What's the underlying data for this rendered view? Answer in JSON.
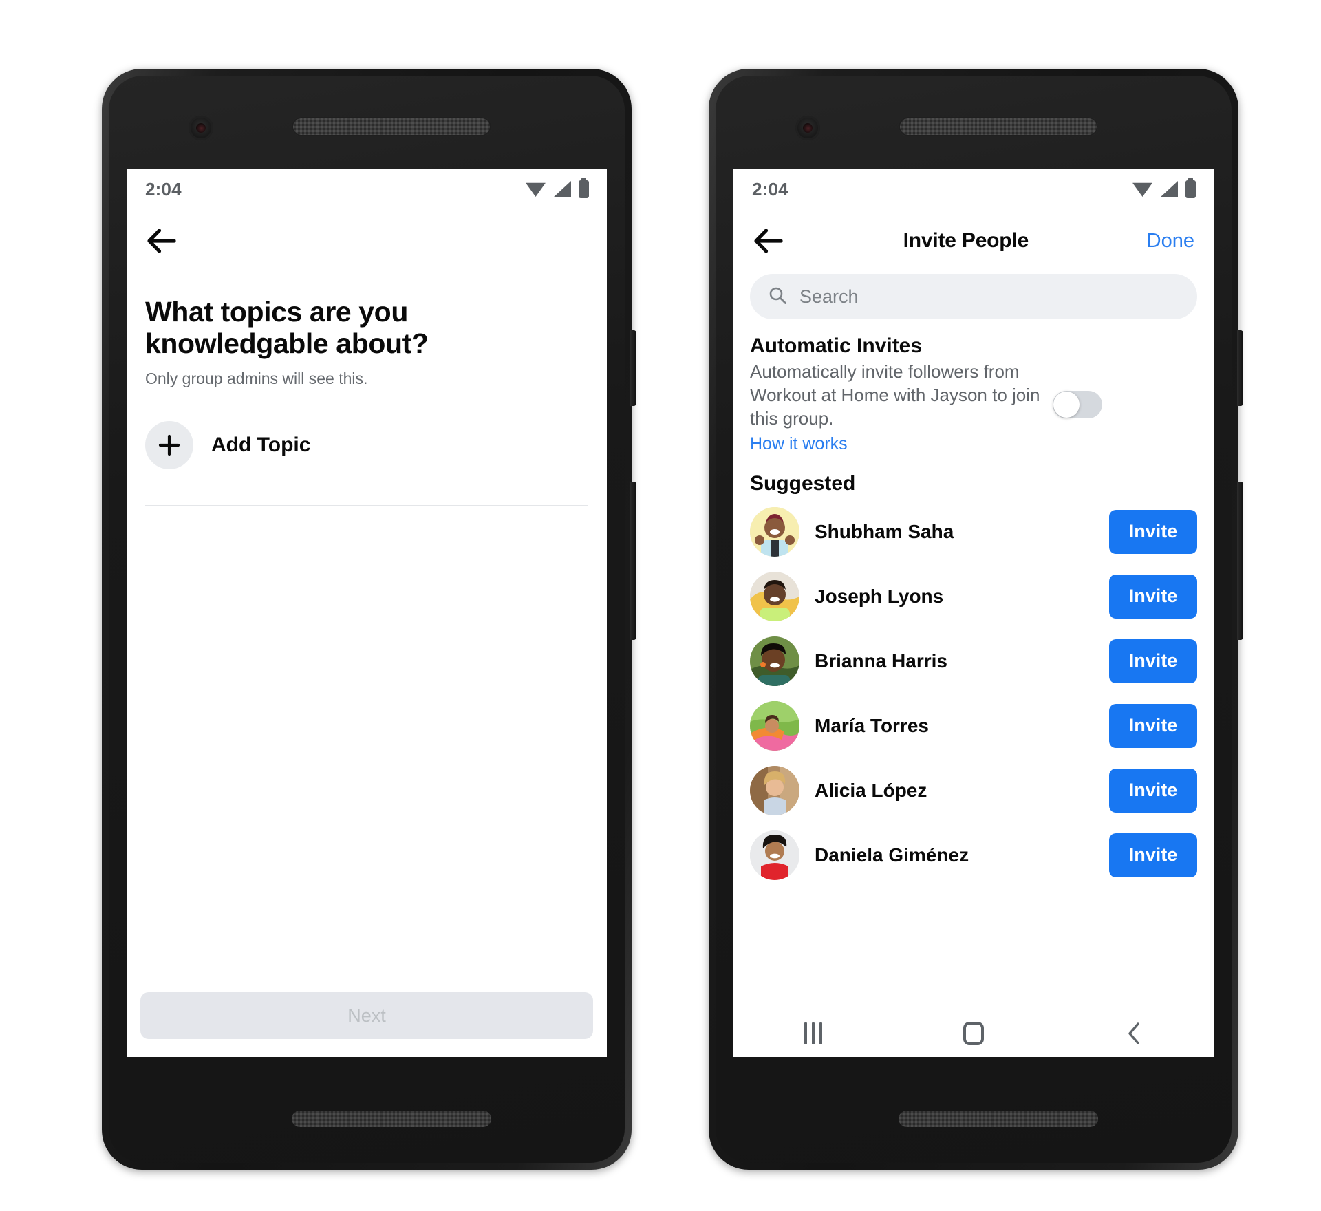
{
  "accent": {
    "blue": "#1877f2",
    "link_blue": "#2a7ef0",
    "text_dark": "#0a0a0a",
    "text_muted": "#65696e",
    "disabled_bg": "#e4e6eb",
    "disabled_text": "#bcc0c4",
    "chip_bg": "#e9ebee",
    "search_bg": "#eef0f3"
  },
  "phone_left": {
    "statusbar": {
      "time": "2:04",
      "icons": [
        "wifi-icon",
        "cellular-signal-icon",
        "battery-icon"
      ]
    },
    "appbar": {
      "back_icon": "back-arrow-icon"
    },
    "screen": {
      "title": "What topics are you knowledgable about?",
      "subtitle": "Only group admins will see this.",
      "add_topic": {
        "icon": "plus-icon",
        "label": "Add Topic"
      },
      "primary_button": {
        "label": "Next",
        "enabled": false
      }
    }
  },
  "phone_right": {
    "statusbar": {
      "time": "2:04",
      "icons": [
        "wifi-icon",
        "cellular-signal-icon",
        "battery-icon"
      ]
    },
    "appbar": {
      "back_icon": "back-arrow-icon",
      "title": "Invite People",
      "action_label": "Done"
    },
    "search": {
      "icon": "search-icon",
      "placeholder": "Search",
      "value": ""
    },
    "automatic_invites": {
      "heading": "Automatic Invites",
      "description": "Automatically invite followers from Workout at Home with Jayson to join this group.",
      "link_label": "How it works",
      "toggle": {
        "name": "automatic-invites-toggle",
        "state": "off"
      }
    },
    "suggested": {
      "heading": "Suggested",
      "invite_label": "Invite",
      "people": [
        {
          "name": "Shubham Saha",
          "avatar": "avatar-shubham-saha",
          "invite_label": "Invite"
        },
        {
          "name": "Joseph Lyons",
          "avatar": "avatar-joseph-lyons",
          "invite_label": "Invite"
        },
        {
          "name": "Brianna Harris",
          "avatar": "avatar-brianna-harris",
          "invite_label": "Invite"
        },
        {
          "name": "María Torres",
          "avatar": "avatar-maria-torres",
          "invite_label": "Invite"
        },
        {
          "name": "Alicia López",
          "avatar": "avatar-alicia-lopez",
          "invite_label": "Invite"
        },
        {
          "name": "Daniela Giménez",
          "avatar": "avatar-daniela-gimenez",
          "invite_label": "Invite"
        }
      ]
    },
    "navbar": {
      "items": [
        "recents-icon",
        "home-icon",
        "back-chevron-icon"
      ]
    }
  }
}
